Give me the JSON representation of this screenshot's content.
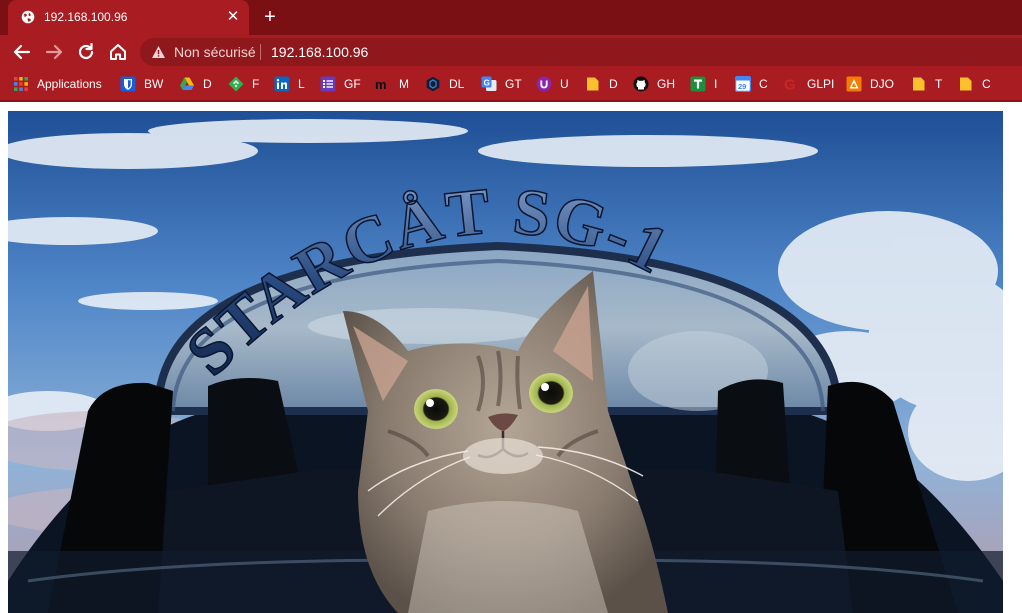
{
  "browser": {
    "tab": {
      "title": "192.168.100.96",
      "favicon": "globe-icon"
    },
    "newtab_icon": "plus-icon",
    "nav": [
      "back-arrow-icon",
      "forward-arrow-icon",
      "reload-icon",
      "home-icon"
    ],
    "omnibox": {
      "security_text": "Non sécurisé",
      "security_icon": "warning-triangle-icon",
      "url": "192.168.100.96"
    },
    "bookmarks": [
      {
        "label": "Applications",
        "icon": "apps-grid-icon"
      },
      {
        "label": "BW",
        "icon": "bitwarden-shield-icon"
      },
      {
        "label": "D",
        "icon": "google-drive-icon"
      },
      {
        "label": "F",
        "icon": "feedly-icon"
      },
      {
        "label": "L",
        "icon": "linkedin-icon"
      },
      {
        "label": "GF",
        "icon": "forms-list-icon"
      },
      {
        "label": "M",
        "icon": "mastodon-icon"
      },
      {
        "label": "DL",
        "icon": "hexagon-icon"
      },
      {
        "label": "GT",
        "icon": "google-translate-icon"
      },
      {
        "label": "U",
        "icon": "purple-u-icon"
      },
      {
        "label": "D",
        "icon": "folder-icon"
      },
      {
        "label": "GH",
        "icon": "github-icon"
      },
      {
        "label": "I",
        "icon": "green-t-icon"
      },
      {
        "label": "C",
        "icon": "calendar-icon"
      },
      {
        "label": "GLPI",
        "icon": "glpi-g-icon"
      },
      {
        "label": "DJO",
        "icon": "orange-grid-icon"
      },
      {
        "label": "T",
        "icon": "folder-icon"
      },
      {
        "label": "C",
        "icon": "folder-icon"
      }
    ],
    "colors": {
      "frame": "#7a1014",
      "toolbar": "#a91c21",
      "omnibox": "#8f181c"
    }
  },
  "page": {
    "hero_title": "STARCÅT SG-1",
    "hero_image": "cat-in-spacecraft-dome-illustration"
  }
}
